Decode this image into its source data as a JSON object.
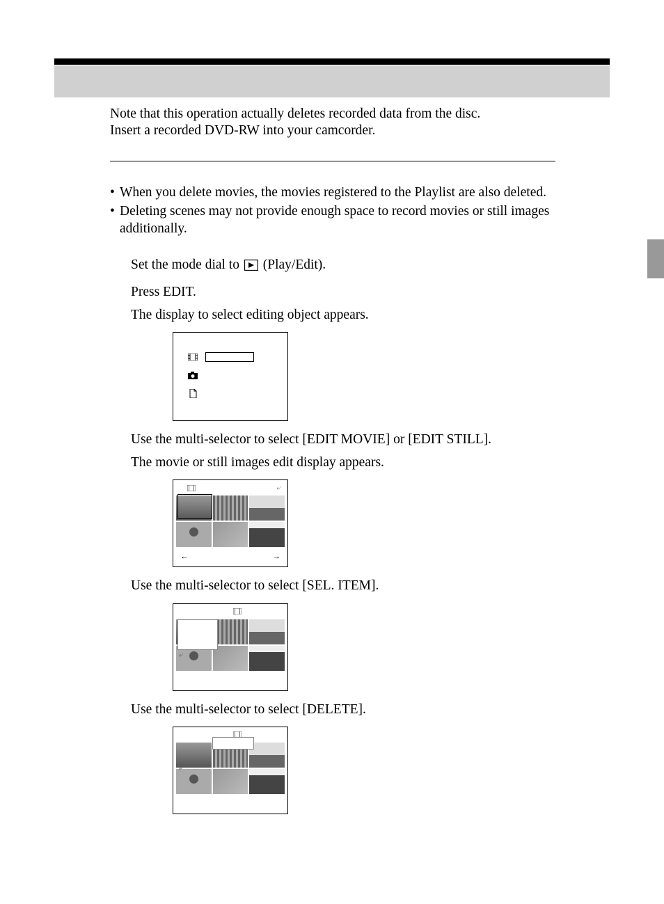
{
  "intro": {
    "l1": "Note that this operation actually deletes recorded data from the disc.",
    "l2": "Insert a recorded DVD-RW into your camcorder."
  },
  "bullets": [
    "When you delete movies, the movies registered to the Playlist are also deleted.",
    "Deleting scenes may not provide enough space to record movies or still images additionally."
  ],
  "steps": {
    "s1_pre": "Set the mode dial to ",
    "s1_post": " (Play/Edit).",
    "s2a": "Press EDIT.",
    "s2b": "The display to select editing object appears.",
    "s3a": "Use the multi-selector to select [EDIT MOVIE] or [EDIT STILL].",
    "s3b": "The movie or still images edit display appears.",
    "s4": "Use the multi-selector to select [SEL. ITEM].",
    "s5": "Use the multi-selector to select [DELETE]."
  },
  "nav": {
    "left": "←",
    "right": "→"
  }
}
